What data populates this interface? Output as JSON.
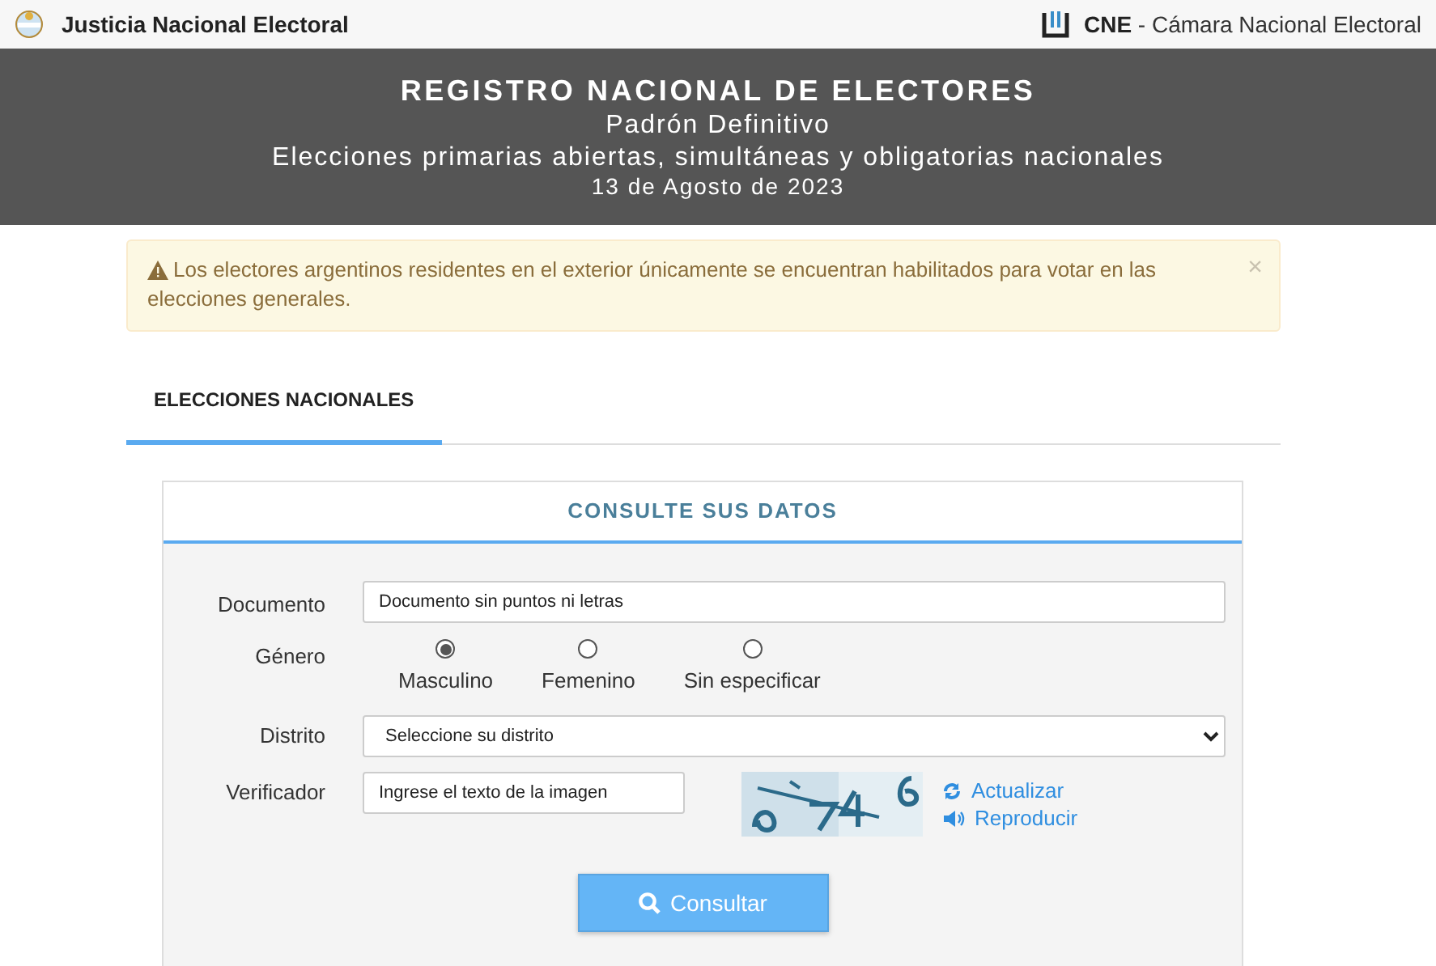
{
  "topbar": {
    "left_title": "Justicia Nacional Electoral",
    "right_abbr": "CNE",
    "right_title": " - Cámara Nacional Electoral"
  },
  "banner": {
    "title": "REGISTRO NACIONAL DE ELECTORES",
    "subtitle": "Padrón Definitivo",
    "election": "Elecciones primarias abiertas, simultáneas y obligatorias nacionales",
    "date": "13 de Agosto de 2023"
  },
  "alert": {
    "message": "Los electores argentinos residentes en el exterior únicamente se encuentran habilitados para votar en las elecciones generales.",
    "close": "×"
  },
  "tabs": [
    {
      "label": "ELECCIONES NACIONALES",
      "selected": true
    }
  ],
  "form": {
    "title": "CONSULTE SUS DATOS",
    "documento": {
      "label": "Documento",
      "placeholder": "Documento sin puntos ni letras"
    },
    "genero": {
      "label": "Género",
      "options": [
        {
          "label": "Masculino",
          "selected": true
        },
        {
          "label": "Femenino",
          "selected": false
        },
        {
          "label": "Sin especificar",
          "selected": false
        }
      ]
    },
    "distrito": {
      "label": "Distrito",
      "value": "Seleccione su distrito"
    },
    "verificador": {
      "label": "Verificador",
      "placeholder": "Ingrese el texto de la imagen",
      "refresh": "Actualizar",
      "play": "Reproducir"
    },
    "submit": "Consultar"
  }
}
